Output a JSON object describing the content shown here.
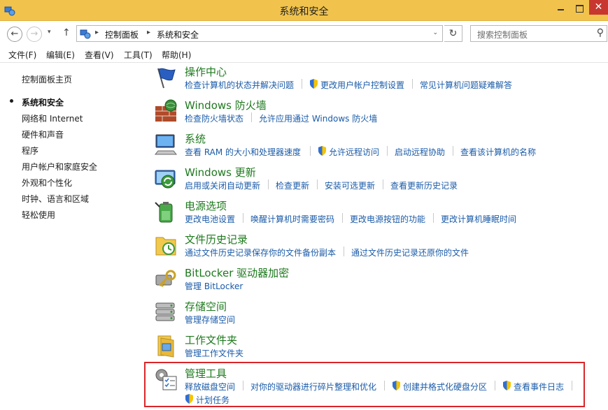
{
  "window": {
    "title": "系统和安全",
    "close_glyph": "✕"
  },
  "nav": {
    "back_glyph": "←",
    "forward_glyph": "→",
    "dropdown_glyph": "▾",
    "up_glyph": "↑",
    "crumb_sep": "▸",
    "breadcrumbs": [
      "控制面板",
      "系统和安全"
    ],
    "addr_dropdown_glyph": "⌄",
    "refresh_glyph": "↻",
    "search_placeholder": "搜索控制面板",
    "search_glyph": "⚲"
  },
  "menu": [
    "文件(F)",
    "编辑(E)",
    "查看(V)",
    "工具(T)",
    "帮助(H)"
  ],
  "sidebar": {
    "home": "控制面板主页",
    "items": [
      "系统和安全",
      "网络和 Internet",
      "硬件和声音",
      "程序",
      "用户帐户和家庭安全",
      "外观和个性化",
      "时钟、语言和区域",
      "轻松使用"
    ]
  },
  "categories": [
    {
      "title": "操作中心",
      "icon": "action-center-flag-icon",
      "links": [
        "检查计算机的状态并解决问题",
        "更改用户帐户控制设置",
        "常见计算机问题疑难解答"
      ]
    },
    {
      "title": "Windows 防火墙",
      "icon": "firewall-brick-icon",
      "links": [
        "检查防火墙状态",
        "允许应用通过 Windows 防火墙"
      ]
    },
    {
      "title": "系统",
      "icon": "system-computer-icon",
      "links": [
        "查看 RAM 的大小和处理器速度",
        "允许远程访问",
        "启动远程协助",
        "查看该计算机的名称"
      ]
    },
    {
      "title": "Windows 更新",
      "icon": "windows-update-icon",
      "links": [
        "启用或关闭自动更新",
        "检查更新",
        "安装可选更新",
        "查看更新历史记录"
      ]
    },
    {
      "title": "电源选项",
      "icon": "power-battery-icon",
      "links": [
        "更改电池设置",
        "唤醒计算机时需要密码",
        "更改电源按钮的功能",
        "更改计算机睡眠时间"
      ]
    },
    {
      "title": "文件历史记录",
      "icon": "file-history-icon",
      "links": [
        "通过文件历史记录保存你的文件备份副本",
        "通过文件历史记录还原你的文件"
      ]
    },
    {
      "title": "BitLocker 驱动器加密",
      "icon": "bitlocker-key-icon",
      "links": [
        "管理 BitLocker"
      ]
    },
    {
      "title": "存储空间",
      "icon": "storage-spaces-icon",
      "links": [
        "管理存储空间"
      ]
    },
    {
      "title": "工作文件夹",
      "icon": "work-folders-icon",
      "links": [
        "管理工作文件夹"
      ]
    },
    {
      "title": "管理工具",
      "icon": "admin-tools-icon",
      "links": [
        "释放磁盘空间",
        "对你的驱动器进行碎片整理和优化",
        "创建并格式化硬盘分区",
        "查看事件日志",
        "计划任务"
      ]
    }
  ],
  "colors": {
    "titlebar": "#f1c34c",
    "link": "#1a5ba8",
    "category_title": "#1e7a1e",
    "highlight": "#d8262a"
  }
}
